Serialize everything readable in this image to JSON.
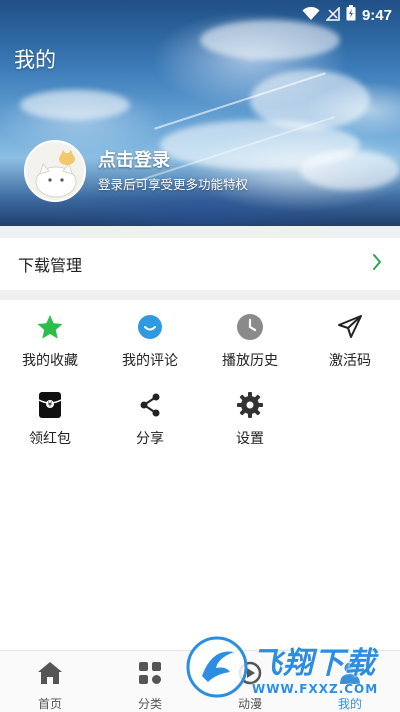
{
  "status_bar": {
    "time": "9:47"
  },
  "header": {
    "title": "我的",
    "login_title": "点击登录",
    "login_subtitle": "登录后可享受更多功能特权"
  },
  "download": {
    "label": "下载管理",
    "arrow_color": "#2aa44f"
  },
  "grid": {
    "row1": [
      {
        "label": "我的收藏",
        "icon": "star-icon",
        "color": "#2dbd4b"
      },
      {
        "label": "我的评论",
        "icon": "comment-icon",
        "color": "#2f9ae0"
      },
      {
        "label": "播放历史",
        "icon": "clock-icon",
        "color": "#8a8a8a"
      },
      {
        "label": "激活码",
        "icon": "send-icon",
        "color": "#222222"
      }
    ],
    "row2": [
      {
        "label": "领红包",
        "icon": "red-packet-icon",
        "color": "#222222"
      },
      {
        "label": "分享",
        "icon": "share-icon",
        "color": "#222222"
      },
      {
        "label": "设置",
        "icon": "gear-icon",
        "color": "#333333"
      }
    ]
  },
  "bottom_nav": {
    "items": [
      {
        "label": "首页",
        "icon": "home-icon"
      },
      {
        "label": "分类",
        "icon": "category-icon"
      },
      {
        "label": "动漫",
        "icon": "anime-icon"
      },
      {
        "label": "我的",
        "icon": "profile-icon",
        "active": true
      }
    ],
    "active_color": "#3a8fd8"
  },
  "watermark": {
    "text": "飞翔下载",
    "url": "WWW.FXXZ.COM"
  }
}
